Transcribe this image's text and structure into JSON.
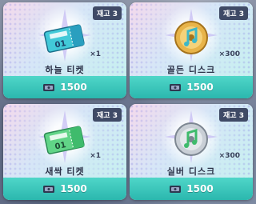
{
  "cards": [
    {
      "stock": "재고 3",
      "name": "하늘 티켓",
      "qty": "×1",
      "price": "1500",
      "icon": "sky-ticket-icon"
    },
    {
      "stock": "재고 3",
      "name": "골든 디스크",
      "qty": "×300",
      "price": "1500",
      "icon": "golden-disc-icon"
    },
    {
      "stock": "재고 3",
      "name": "새싹 티켓",
      "qty": "×1",
      "price": "1500",
      "icon": "sprout-ticket-icon"
    },
    {
      "stock": "재고 3",
      "name": "실버 디스크",
      "qty": "×300",
      "price": "1500",
      "icon": "silver-disc-icon"
    }
  ],
  "colors": {
    "price_bar": "#2bb7ae",
    "badge": "#3f4a66",
    "sky_ticket": "#42c9d8",
    "sprout_ticket": "#61d487",
    "gold": "#e8b44a",
    "silver": "#c9cfd6"
  },
  "currency_icon": "ticket-currency-icon"
}
